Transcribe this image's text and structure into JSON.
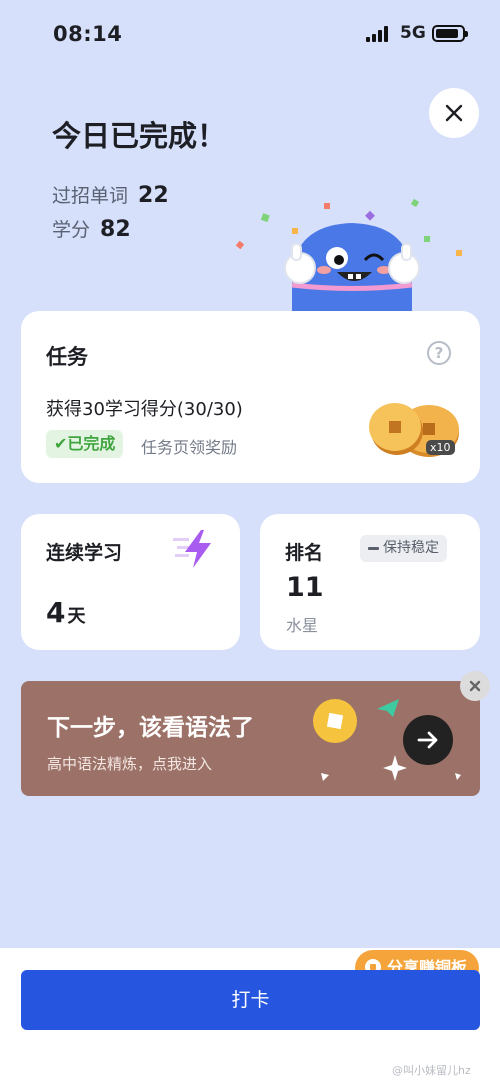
{
  "status_bar": {
    "time": "08:14",
    "network": "5G"
  },
  "header": {
    "title": "今日已完成！"
  },
  "stats": [
    {
      "label": "过招单词",
      "value": "22"
    },
    {
      "label": "学分",
      "value": "82"
    }
  ],
  "task_card": {
    "title": "任务",
    "help_icon": "?",
    "description": "获得30学习得分(30/30)",
    "done_label": "✔已完成",
    "hint": "任务页领奖励",
    "reward_multiplier": "x10"
  },
  "streak_card": {
    "title": "连续学习",
    "value": "4",
    "unit": "天"
  },
  "rank_card": {
    "title": "排名",
    "trend_label": "保持稳定",
    "value": "11",
    "tier": "水星"
  },
  "banner": {
    "title": "下一步，该看语法了",
    "subtitle": "高中语法精炼，点我进入"
  },
  "share": {
    "label": "分享赚铜板"
  },
  "checkin_button": {
    "label": "打卡"
  },
  "watermark": "@叫小妹留儿hz"
}
